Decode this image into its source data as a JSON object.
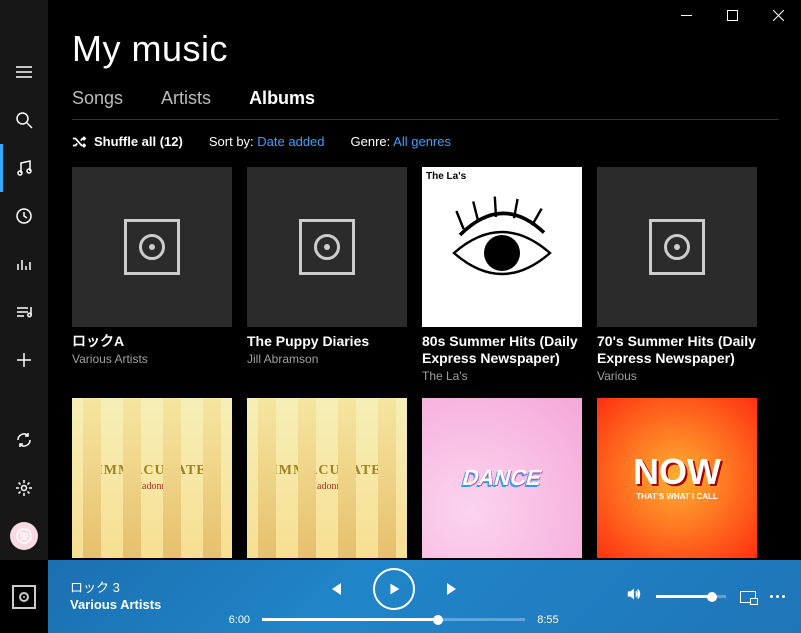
{
  "header": {
    "title": "My music"
  },
  "tabs": {
    "songs": "Songs",
    "artists": "Artists",
    "albums": "Albums",
    "active": "albums"
  },
  "toolbar": {
    "shuffle_label": "Shuffle all (12)",
    "sort_label": "Sort by:",
    "sort_value": "Date added",
    "genre_label": "Genre:",
    "genre_value": "All genres"
  },
  "albums": [
    {
      "title": "ロックA",
      "artist": "Various Artists",
      "art": "placeholder"
    },
    {
      "title": "The Puppy Diaries",
      "artist": "Jill Abramson",
      "art": "placeholder"
    },
    {
      "title": "80s Summer Hits (Daily Express Newspaper)",
      "artist": "The La's",
      "art": "eye",
      "art_label": "The La's"
    },
    {
      "title": "70's Summer Hits (Daily Express Newspaper)",
      "artist": "Various",
      "art": "placeholder"
    },
    {
      "title": "",
      "artist": "",
      "art": "immaculate"
    },
    {
      "title": "",
      "artist": "",
      "art": "immaculate"
    },
    {
      "title": "",
      "artist": "",
      "art": "dance"
    },
    {
      "title": "",
      "artist": "",
      "art": "now"
    }
  ],
  "player": {
    "track_title": "ロック 3",
    "track_artist": "Various Artists",
    "elapsed": "6:00",
    "total": "8:55",
    "progress_pct": 67,
    "volume_pct": 80
  },
  "art_text": {
    "immaculate_big": "IMMACULATE",
    "immaculate_small": "Madonna",
    "dance": "DANCE",
    "now_big": "NOW",
    "now_small": "THAT'S WHAT I CALL"
  }
}
